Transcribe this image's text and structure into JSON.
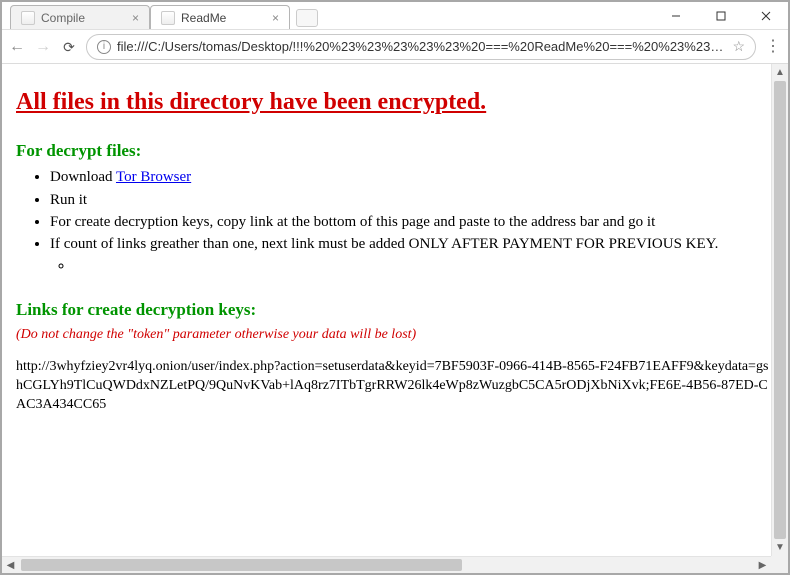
{
  "window": {
    "minimize_tip": "Minimize",
    "maximize_tip": "Maximize",
    "close_tip": "Close"
  },
  "tabs": [
    {
      "title": "Compile",
      "active": false
    },
    {
      "title": "ReadMe",
      "active": true
    }
  ],
  "address": {
    "url": "file:///C:/Users/tomas/Desktop/!!!%20%23%23%23%23%23%20===%20ReadMe%20===%20%23%23%23%23%23...",
    "scheme_tip": "View site information",
    "star_tip": "Bookmark this page",
    "menu_tip": "Customize and control"
  },
  "content": {
    "heading": "All files in this directory have been encrypted.",
    "section_decrypt": "For decrypt files:",
    "steps": {
      "download_prefix": "Download ",
      "tor_link_text": "Tor Browser",
      "run_it": "Run it",
      "copy_link": "For create decryption keys, copy link at the bottom of this page and paste to the address bar and go it",
      "count_links": "If count of links greather than one, next link must be added ONLY AFTER PAYMENT FOR PREVIOUS KEY."
    },
    "section_links": "Links for create decryption keys:",
    "warn": "(Do not change the \"token\" parameter otherwise your data will be lost)",
    "onion_url": "http://3whyfziey2vr4lyq.onion/user/index.php?action=setuserdata&keyid=7BF5903F-0966-414B-8565-F24FB71EAFF9&keydata=gshCGLYh9TlCuQWDdxNZLetPQ/9QuNvKVab+lAq8rz7ITbTgrRRW26lk4eWp8zWuzgbC5CA5rODjXbNiXvk;FE6E-4B56-87ED-CAC3A434CC65"
  }
}
